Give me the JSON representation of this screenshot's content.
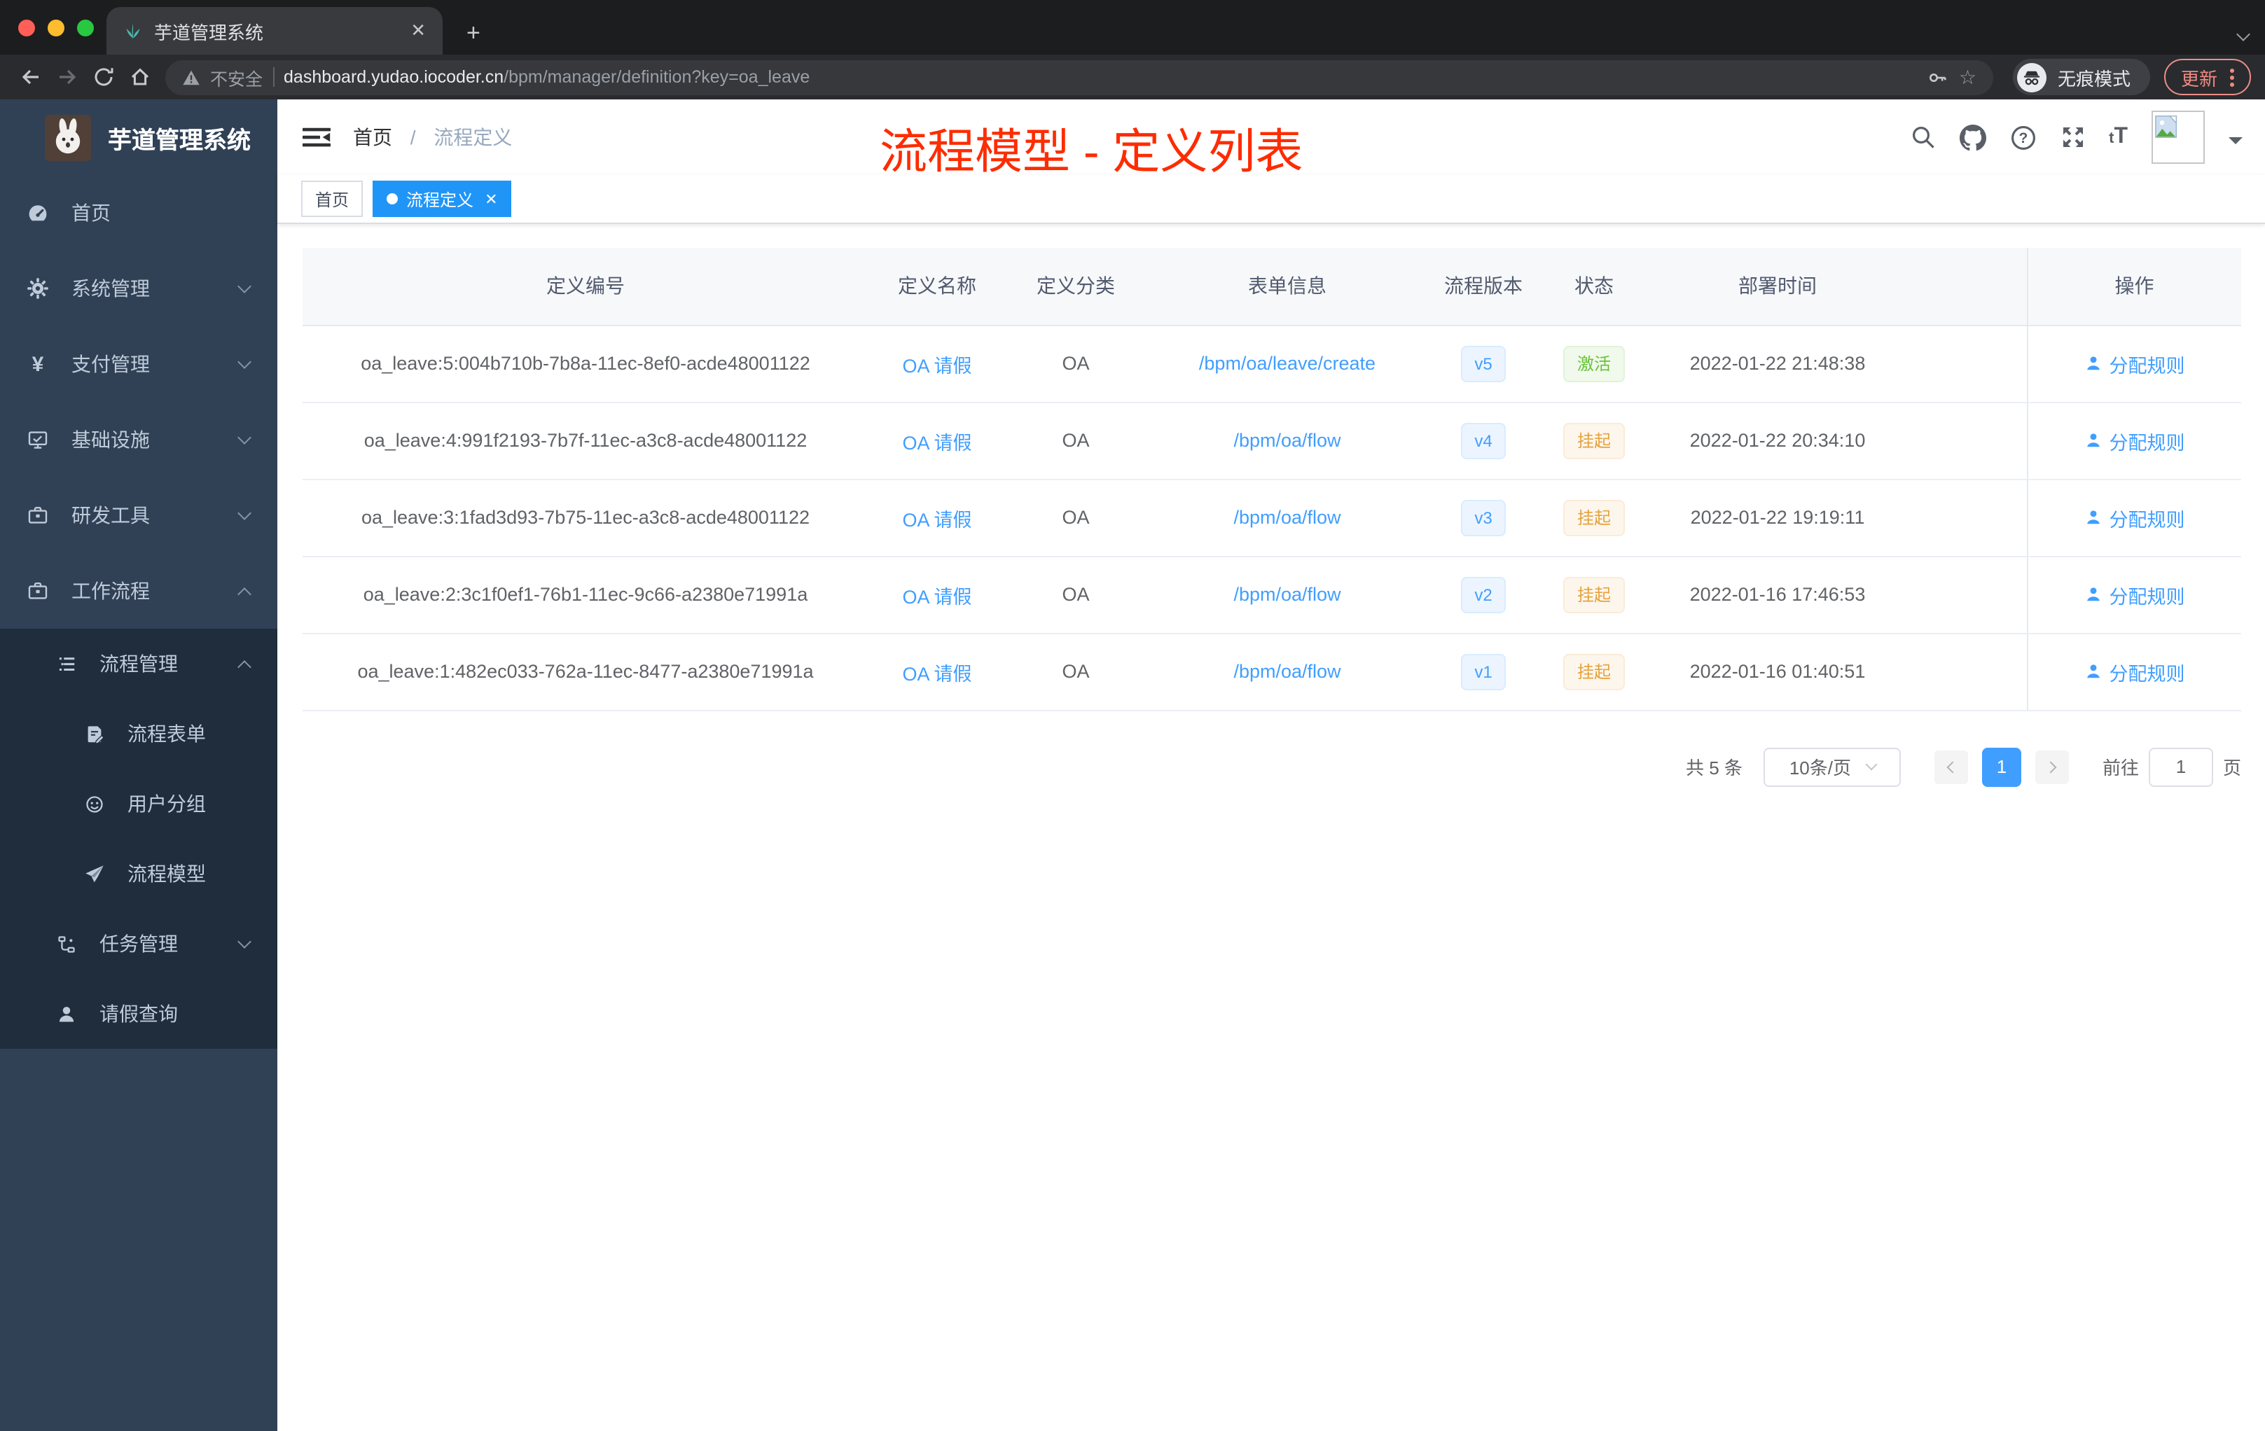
{
  "browser": {
    "tab": {
      "title": "芋道管理系统",
      "close_glyph": "✕",
      "new_tab_glyph": "+"
    },
    "address": {
      "security_label": "不安全",
      "url_host": "dashboard.yudao.iocoder.cn",
      "url_path": "/bpm/manager/definition?key=oa_leave"
    },
    "incognito_label": "无痕模式",
    "update_label": "更新"
  },
  "sidebar": {
    "logo_title": "芋道管理系统",
    "menu": [
      {
        "label": "首页"
      },
      {
        "label": "系统管理"
      },
      {
        "label": "支付管理"
      },
      {
        "label": "基础设施"
      },
      {
        "label": "研发工具"
      },
      {
        "label": "工作流程"
      }
    ],
    "submenu": [
      {
        "label": "流程管理"
      },
      {
        "label": "流程表单"
      },
      {
        "label": "用户分组"
      },
      {
        "label": "流程模型"
      },
      {
        "label": "任务管理"
      },
      {
        "label": "请假查询"
      }
    ]
  },
  "header": {
    "breadcrumb_home": "首页",
    "breadcrumb_separator": "/",
    "breadcrumb_current": "流程定义",
    "annotation": "流程模型 - 定义列表"
  },
  "tags": [
    {
      "label": "首页",
      "active": false
    },
    {
      "label": "流程定义",
      "active": true,
      "close_glyph": "✕"
    }
  ],
  "table": {
    "columns": [
      "定义编号",
      "定义名称",
      "定义分类",
      "表单信息",
      "流程版本",
      "状态",
      "部署时间",
      "操作"
    ],
    "rows": [
      {
        "id": "oa_leave:5:004b710b-7b8a-11ec-8ef0-acde48001122",
        "name": "OA 请假",
        "category": "OA",
        "form": "/bpm/oa/leave/create",
        "version": "v5",
        "status": "激活",
        "status_type": "success",
        "deploy_time": "2022-01-22 21:48:38",
        "action": "分配规则"
      },
      {
        "id": "oa_leave:4:991f2193-7b7f-11ec-a3c8-acde48001122",
        "name": "OA 请假",
        "category": "OA",
        "form": "/bpm/oa/flow",
        "version": "v4",
        "status": "挂起",
        "status_type": "warning",
        "deploy_time": "2022-01-22 20:34:10",
        "action": "分配规则"
      },
      {
        "id": "oa_leave:3:1fad3d93-7b75-11ec-a3c8-acde48001122",
        "name": "OA 请假",
        "category": "OA",
        "form": "/bpm/oa/flow",
        "version": "v3",
        "status": "挂起",
        "status_type": "warning",
        "deploy_time": "2022-01-22 19:19:11",
        "action": "分配规则"
      },
      {
        "id": "oa_leave:2:3c1f0ef1-76b1-11ec-9c66-a2380e71991a",
        "name": "OA 请假",
        "category": "OA",
        "form": "/bpm/oa/flow",
        "version": "v2",
        "status": "挂起",
        "status_type": "warning",
        "deploy_time": "2022-01-16 17:46:53",
        "action": "分配规则"
      },
      {
        "id": "oa_leave:1:482ec033-762a-11ec-8477-a2380e71991a",
        "name": "OA 请假",
        "category": "OA",
        "form": "/bpm/oa/flow",
        "version": "v1",
        "status": "挂起",
        "status_type": "warning",
        "deploy_time": "2022-01-16 01:40:51",
        "action": "分配规则"
      }
    ]
  },
  "pagination": {
    "total_label": "共 5 条",
    "page_size": "10条/页",
    "current_page": "1",
    "goto_label": "前往",
    "goto_value": "1",
    "page_suffix": "页"
  },
  "colors": {
    "accent": "#409eff",
    "tag_active": "#1f95f8",
    "success": "#67c23a",
    "warning": "#e6a23c",
    "annotation_red": "#fd2c01",
    "sidebar_bg": "#304156",
    "submenu_bg": "#1f2d3d",
    "chrome_strip": "#1c1d1f",
    "chrome_toolbar": "#2a2b2e",
    "update_salmon": "#f08983"
  }
}
